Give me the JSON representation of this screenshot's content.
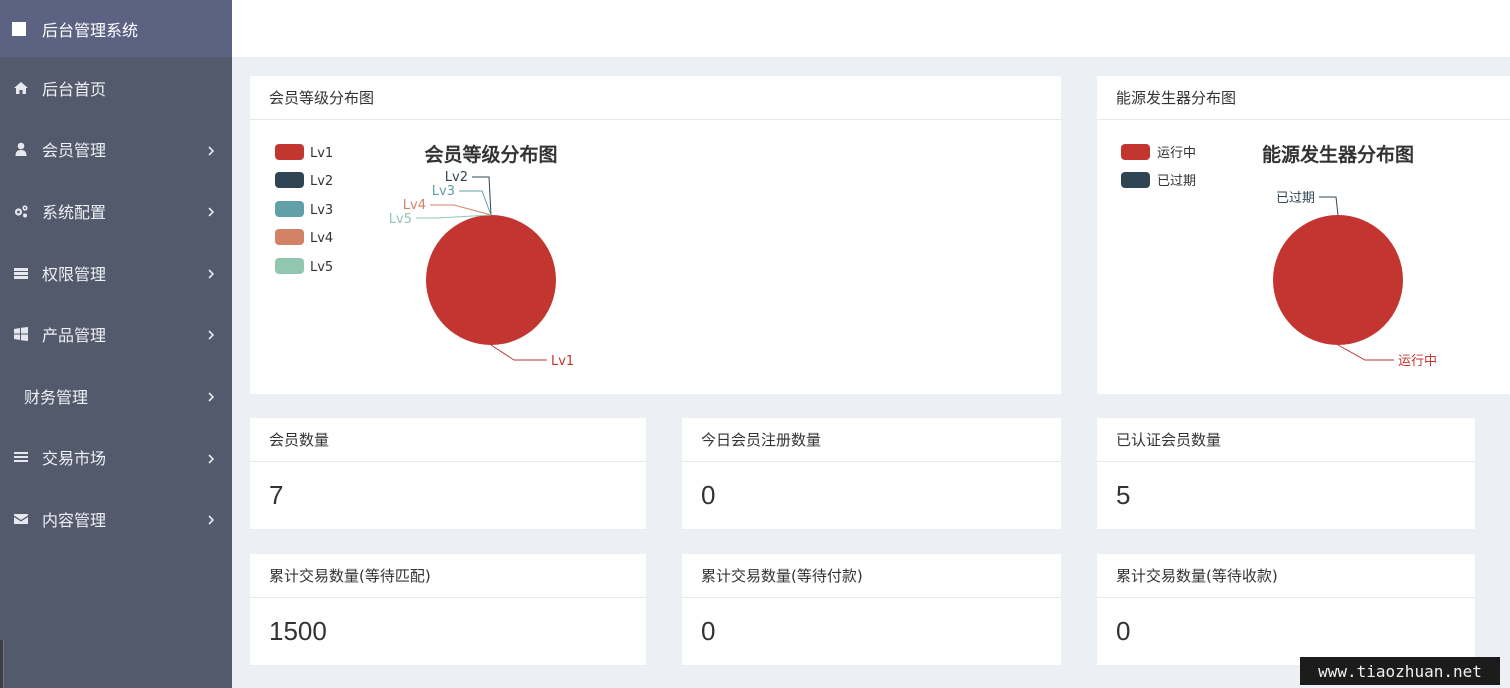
{
  "app": {
    "title": "后台管理系统"
  },
  "sidebar": {
    "items": [
      {
        "label": "后台首页",
        "icon": "home-icon",
        "expandable": false
      },
      {
        "label": "会员管理",
        "icon": "user-icon",
        "expandable": true
      },
      {
        "label": "系统配置",
        "icon": "gears-icon",
        "expandable": true
      },
      {
        "label": "权限管理",
        "icon": "server-icon",
        "expandable": true
      },
      {
        "label": "产品管理",
        "icon": "windows-icon",
        "expandable": true
      },
      {
        "label": "财务管理",
        "icon": "",
        "expandable": true
      },
      {
        "label": "交易市场",
        "icon": "bars-icon",
        "expandable": true
      },
      {
        "label": "内容管理",
        "icon": "envelope-icon",
        "expandable": true
      }
    ]
  },
  "panels": {
    "member_level": {
      "header": "会员等级分布图",
      "chart_data": {
        "type": "pie",
        "title": "会员等级分布图",
        "categories": [
          "Lv1",
          "Lv2",
          "Lv3",
          "Lv4",
          "Lv5"
        ],
        "values": [
          7,
          0,
          0,
          0,
          0
        ],
        "colors": [
          "#c23531",
          "#2f4554",
          "#61a0a8",
          "#d48265",
          "#91c7ae"
        ],
        "legend": "left"
      }
    },
    "generator": {
      "header": "能源发生器分布图",
      "chart_data": {
        "type": "pie",
        "title": "能源发生器分布图",
        "categories": [
          "运行中",
          "已过期"
        ],
        "values": [
          1,
          0
        ],
        "colors": [
          "#c23531",
          "#2f4554"
        ],
        "legend": "left"
      }
    }
  },
  "stats": [
    {
      "label": "会员数量",
      "value": "7"
    },
    {
      "label": "今日会员注册数量",
      "value": "0"
    },
    {
      "label": "已认证会员数量",
      "value": "5"
    },
    {
      "label": "累计交易数量(等待匹配)",
      "value": "1500"
    },
    {
      "label": "累计交易数量(等待付款)",
      "value": "0"
    },
    {
      "label": "累计交易数量(等待收款)",
      "value": "0"
    }
  ],
  "watermark": "www.tiaozhuan.net"
}
